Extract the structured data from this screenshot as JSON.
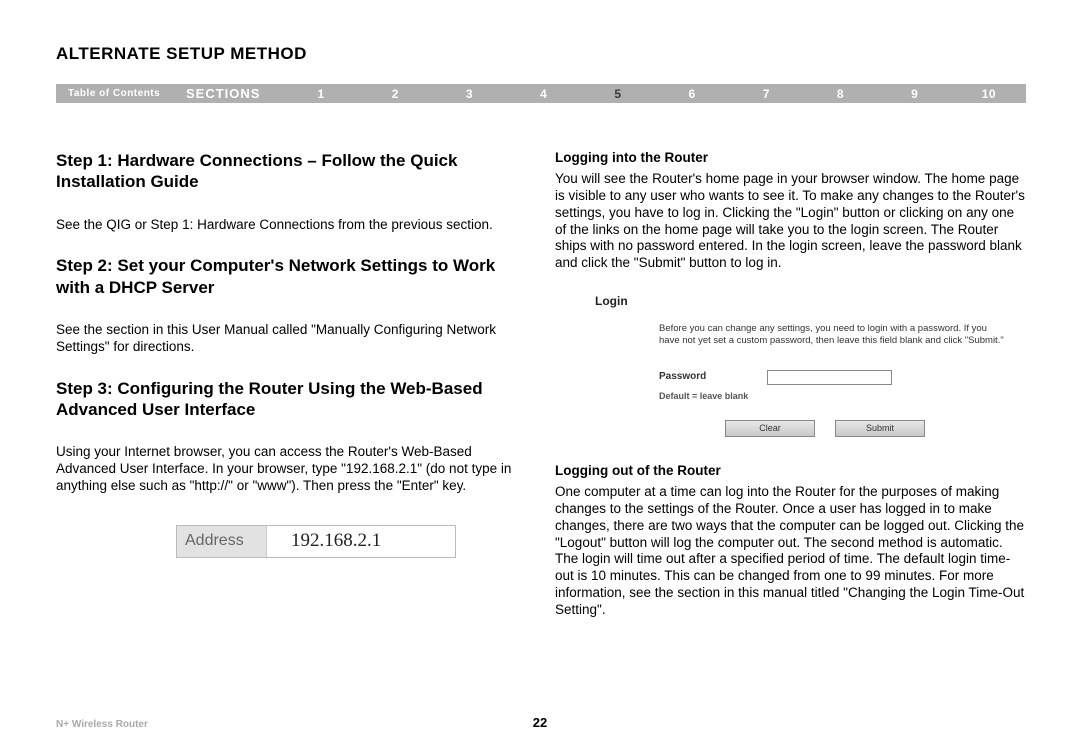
{
  "page_title": "ALTERNATE SETUP METHOD",
  "nav": {
    "toc": "Table of Contents",
    "sections": "SECTIONS",
    "items": [
      "1",
      "2",
      "3",
      "4",
      "5",
      "6",
      "7",
      "8",
      "9",
      "10"
    ],
    "active_index": 4
  },
  "left": {
    "step1_title": "Step 1: Hardware Connections – Follow the Quick Installation Guide",
    "step1_body": "See the QIG or Step 1: Hardware Connections from the previous section.",
    "step2_title": "Step 2: Set your Computer's Network Settings to Work with a DHCP Server",
    "step2_body": "See the section in this User Manual called \"Manually Configuring Network Settings\" for directions.",
    "step3_title": "Step 3: Configuring the Router Using the Web-Based Advanced User Interface",
    "step3_body": "Using your Internet browser, you can access the Router's Web-Based Advanced User Interface. In your browser, type \"192.168.2.1\" (do not type in anything else such as \"http://\" or \"www\"). Then press the \"Enter\" key.",
    "address_label": "Address",
    "address_value": "192.168.2.1"
  },
  "right": {
    "login_heading": "Logging into the Router",
    "login_body": "You will see the Router's home page in your browser window. The home page is visible to any user who wants to see it. To make any changes to the Router's settings, you have to log in. Clicking the \"Login\" button or clicking on any one of the links on the home page will take you to the login screen. The Router ships with no password entered. In the login screen, leave the password blank and click the \"Submit\" button to log in.",
    "login_box": {
      "title": "Login",
      "desc": "Before you can change any settings, you need to login with a password. If you have not yet set a custom password, then leave this field blank and click \"Submit.\"",
      "pw_label": "Password",
      "default": "Default = leave blank",
      "clear": "Clear",
      "submit": "Submit"
    },
    "logout_heading": "Logging out of the Router",
    "logout_body": "One computer at a time can log into the Router for the purposes of making changes to the settings of the Router. Once a user has logged in to make changes, there are two ways that the computer can be logged out. Clicking the \"Logout\" button will log the computer out. The second method is automatic. The login will time out after a specified period of time. The default login time-out is 10 minutes. This can be changed from one to 99 minutes. For more information, see the section in this manual titled \"Changing the Login Time-Out Setting\"."
  },
  "footer": {
    "product": "N+ Wireless Router",
    "page": "22"
  }
}
